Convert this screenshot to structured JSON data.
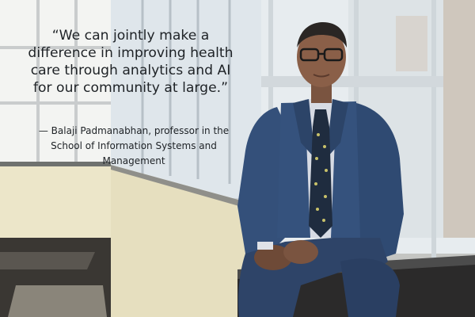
{
  "quote": {
    "lines": [
      "“We can jointly make a",
      "difference in improving health",
      "care through analytics and AI",
      "for our community at large.”"
    ]
  },
  "attribution": {
    "lines": [
      "— Balaji Padmanabhan, professor in the",
      "School of Information Systems and",
      "Management"
    ]
  },
  "colors": {
    "suit": "#34507a",
    "wall": "#e9e2c6",
    "text": "#1e2226"
  }
}
